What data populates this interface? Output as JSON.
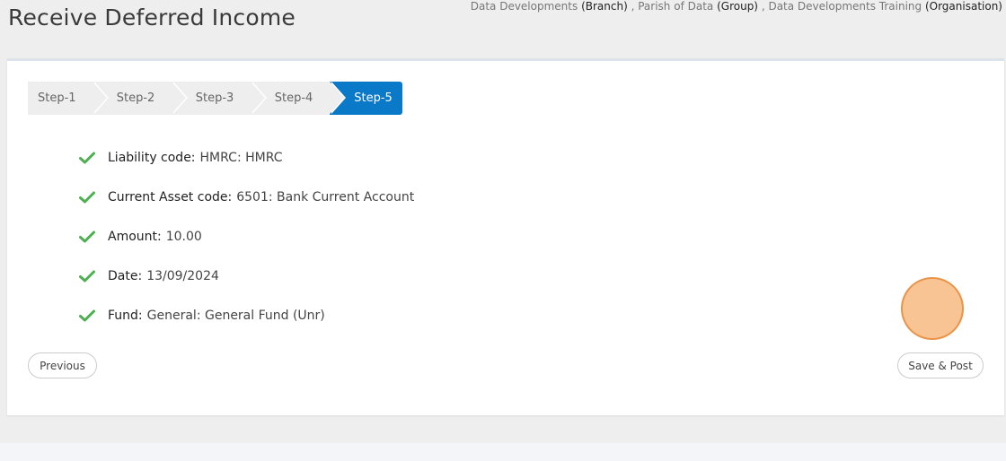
{
  "header": {
    "title": "Receive Deferred Income",
    "context": [
      {
        "name": "Data Developments",
        "type": "(Branch)"
      },
      {
        "name": "Parish of Data",
        "type": "(Group)"
      },
      {
        "name": "Data Developments Training",
        "type": "(Organisation)"
      }
    ],
    "separator": " , "
  },
  "steps": [
    {
      "label": "Step-1",
      "active": false
    },
    {
      "label": "Step-2",
      "active": false
    },
    {
      "label": "Step-3",
      "active": false
    },
    {
      "label": "Step-4",
      "active": false
    },
    {
      "label": "Step-5",
      "active": true
    }
  ],
  "summary": [
    {
      "label": "Liability code:",
      "value": "HMRC: HMRC",
      "icon": "check-icon"
    },
    {
      "label": "Current Asset code:",
      "value": "6501: Bank Current Account",
      "icon": "check-icon"
    },
    {
      "label": "Amount:",
      "value": "10.00",
      "icon": "check-icon"
    },
    {
      "label": "Date:",
      "value": "13/09/2024",
      "icon": "check-icon"
    },
    {
      "label": "Fund:",
      "value": "General: General Fund (Unr)",
      "icon": "check-icon"
    }
  ],
  "buttons": {
    "previous": "Previous",
    "save_post": "Save & Post"
  },
  "colors": {
    "accent": "#0a79c8",
    "check": "#4caf50",
    "click_indicator": "#f5a050"
  }
}
